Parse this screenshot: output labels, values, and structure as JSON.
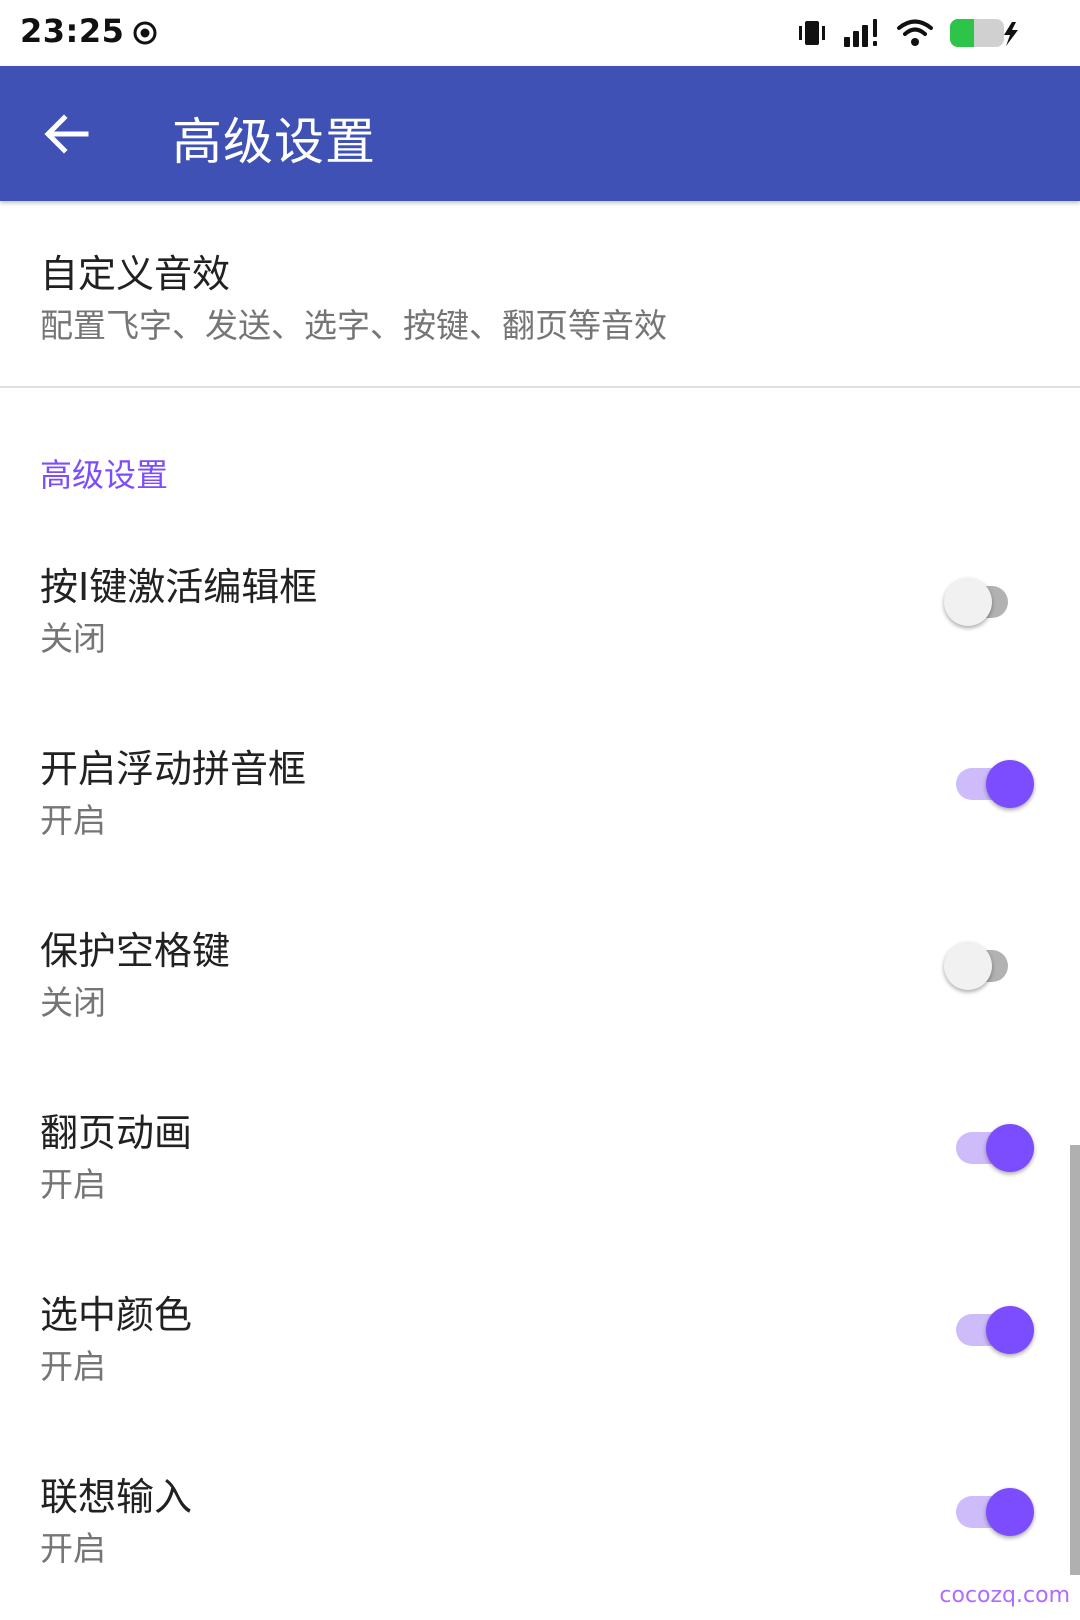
{
  "status_bar": {
    "time": "23:25",
    "icons": [
      "record-icon",
      "vibrate-icon",
      "signal-icon",
      "wifi-icon",
      "battery-icon"
    ]
  },
  "app_bar": {
    "title": "高级设置",
    "color": "#3f51b5"
  },
  "top_pref": {
    "title": "自定义音效",
    "summary": "配置飞字、发送、选字、按键、翻页等音效"
  },
  "section_header": "高级设置",
  "accent_color": "#7c4dff",
  "settings": [
    {
      "title": "按I键激活编辑框",
      "summary": "关闭",
      "enabled": false
    },
    {
      "title": "开启浮动拼音框",
      "summary": "开启",
      "enabled": true
    },
    {
      "title": "保护空格键",
      "summary": "关闭",
      "enabled": false
    },
    {
      "title": "翻页动画",
      "summary": "开启",
      "enabled": true
    },
    {
      "title": "选中颜色",
      "summary": "开启",
      "enabled": true
    },
    {
      "title": "联想输入",
      "summary": "开启",
      "enabled": true
    }
  ],
  "watermark": "cocozq.com"
}
